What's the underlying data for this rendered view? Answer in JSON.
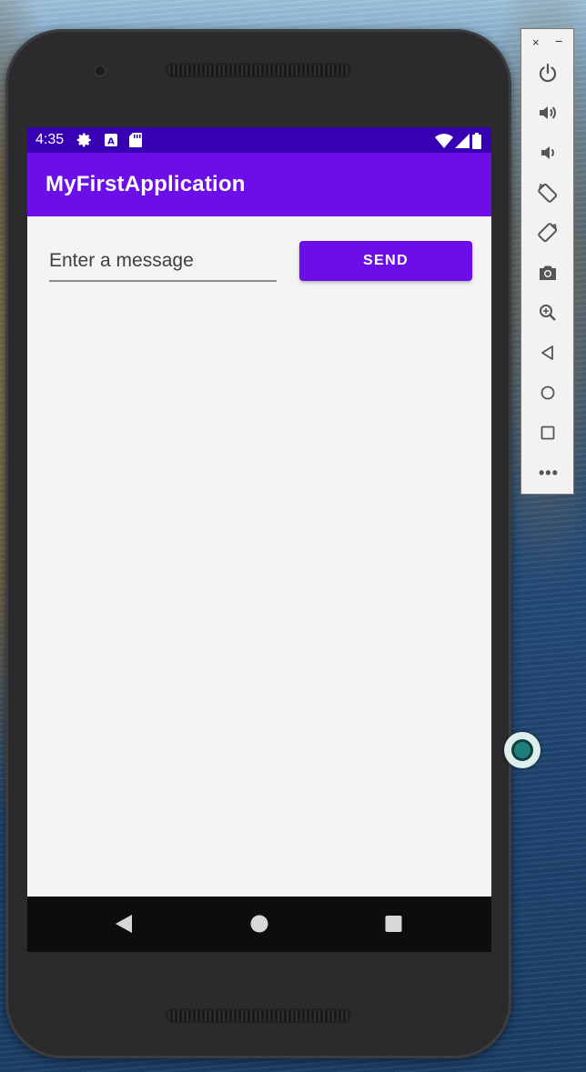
{
  "status_bar": {
    "time": "4:35",
    "left_icons": [
      "gear-icon",
      "a-box-icon",
      "sd-card-icon"
    ],
    "right_icons": [
      "wifi-icon",
      "cell-signal-icon",
      "battery-icon"
    ]
  },
  "app": {
    "title": "MyFirstApplication"
  },
  "message": {
    "placeholder": "Enter a message",
    "value": ""
  },
  "send_button": {
    "label": "SEND"
  },
  "navigation": [
    "back-icon",
    "home-icon",
    "recents-icon"
  ],
  "emulator_toolbar": {
    "close_label": "×",
    "minimize_label": "−",
    "tools": [
      "power-icon",
      "volume-up-icon",
      "volume-down-icon",
      "rotate-left-icon",
      "rotate-right-icon",
      "camera-icon",
      "zoom-icon",
      "back-icon",
      "home-icon",
      "overview-icon"
    ],
    "more_label": "•••"
  },
  "colors": {
    "status_bar": "#3700b3",
    "primary": "#6c0ee7",
    "screen_background": "#f4f4f4",
    "nav_bar": "#0d0d0d"
  }
}
